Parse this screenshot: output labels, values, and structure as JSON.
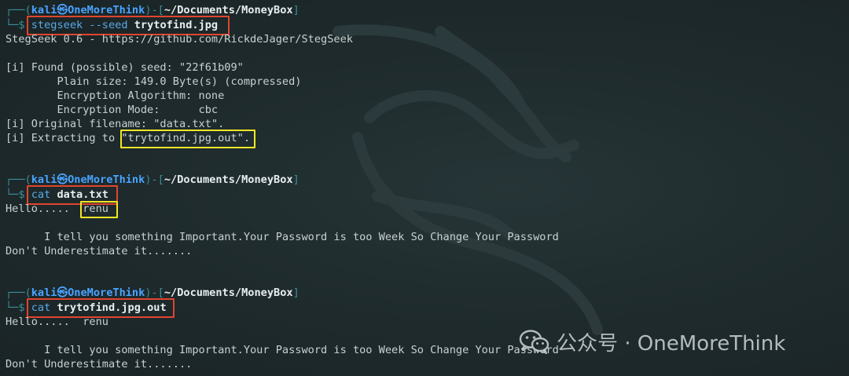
{
  "session_1": {
    "prompt_open": "┌──(",
    "user": "kali",
    "at": "㉿",
    "host": "OneMoreThink",
    "sep": ")-[",
    "path": "~/Documents/MoneyBox",
    "close": "]",
    "dollar_prefix": "└─$ ",
    "command": "stegseek",
    "args": "--seed",
    "file": "trytofind.jpg",
    "output": [
      "StegSeek 0.6 - https://github.com/RickdeJager/StegSeek",
      "",
      "[i] Found (possible) seed: \"22f61b09\"",
      "        Plain size: 149.0 Byte(s) (compressed)",
      "        Encryption Algorithm: none",
      "        Encryption Mode:      cbc",
      "[i] Original filename: \"data.txt\".",
      "[i] Extracting to \"trytofind.jpg.out\"."
    ]
  },
  "session_2": {
    "prompt_open": "┌──(",
    "user": "kali",
    "at": "㉿",
    "host": "OneMoreThink",
    "sep": ")-[",
    "path": "~/Documents/MoneyBox",
    "close": "]",
    "dollar_prefix": "└─$ ",
    "command": "cat",
    "file": "data.txt",
    "output": [
      "Hello.....  renu",
      "",
      "      I tell you something Important.Your Password is too Week So Change Your Password",
      "Don't Underestimate it......."
    ]
  },
  "session_3": {
    "prompt_open": "┌──(",
    "user": "kali",
    "at": "㉿",
    "host": "OneMoreThink",
    "sep": ")-[",
    "path": "~/Documents/MoneyBox",
    "close": "]",
    "dollar_prefix": "└─$ ",
    "command": "cat",
    "file": "trytofind.jpg.out",
    "output": [
      "Hello.....  renu",
      "",
      "      I tell you something Important.Your Password is too Week So Change Your Password",
      "Don't Underestimate it......."
    ]
  },
  "watermark": {
    "text": "公众号 · OneMoreThink",
    "icon": "wechat-icon"
  },
  "colors": {
    "background": "#1f2b2d",
    "highlight_red": "#e0452f",
    "highlight_yellow": "#f2e627",
    "prompt_blue": "#4aa3ff",
    "frame_teal": "#4aa3a8"
  }
}
